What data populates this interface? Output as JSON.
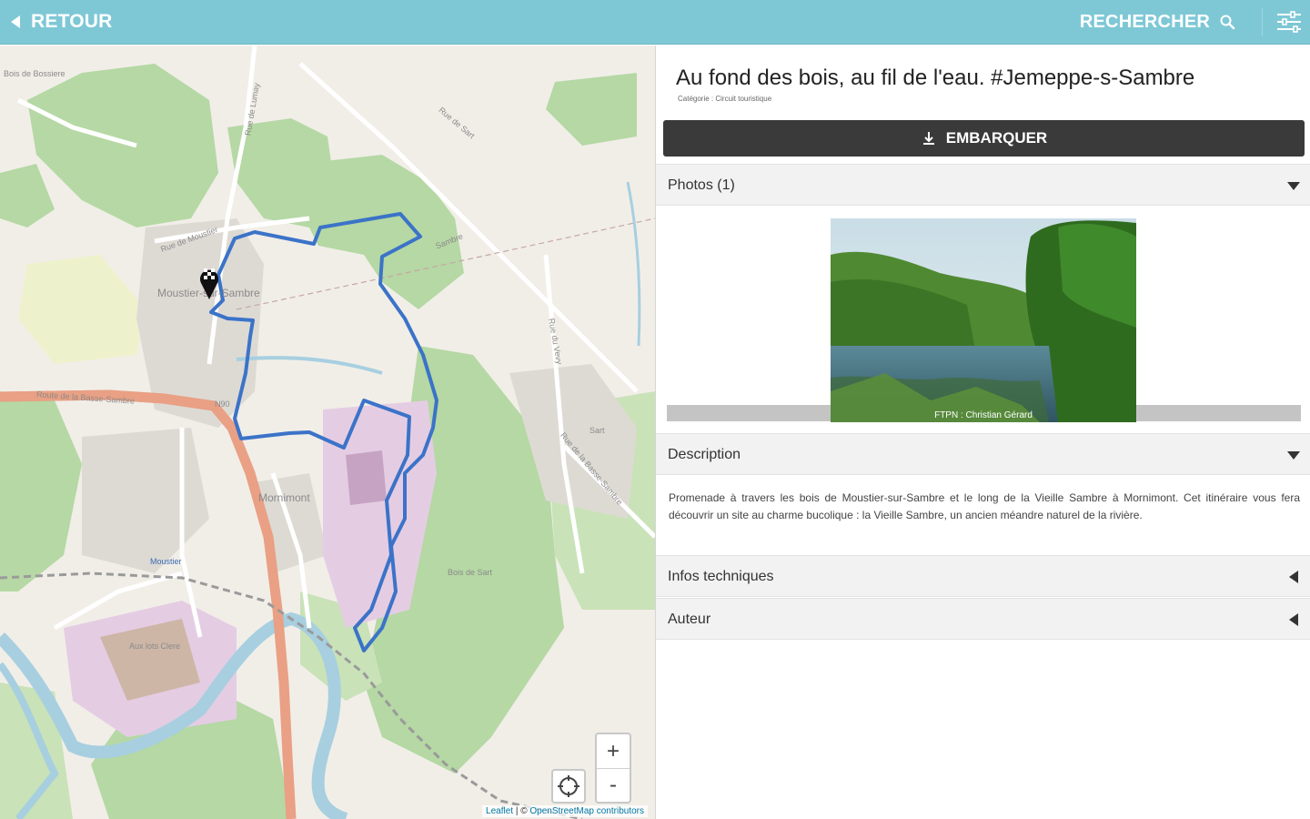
{
  "topbar": {
    "back_label": "RETOUR",
    "search_label": "RECHERCHER",
    "bg_color": "#7ec8d6"
  },
  "map": {
    "labels": {
      "moustier": "Moustier-sur-Sambre",
      "mornimont": "Mornimont",
      "moustier_station": "Moustier",
      "bois_de_sart": "Bois de Sart",
      "rue_de_la_basse_sambre": "Route de la Basse-Sambre",
      "route_n90": "N90",
      "rue_de_sart": "Rue de Sart",
      "rue_du_vevy": "Rue du Vevy",
      "rue_de_la_basse_sambre2": "Rue de la Basse-Sambre",
      "rue_de_moustier": "Rue de Moustier",
      "aux_lots": "Aux lots Clere",
      "bois_de_bossiere": "Bois de Bossiere",
      "rue_de_lumay": "Rue de Lumay",
      "sart": "Sart",
      "sambre": "Sambre"
    },
    "zoom_in_label": "+",
    "zoom_out_label": "-",
    "attribution_leaflet": "Leaflet",
    "attribution_sep": " | © ",
    "attribution_osm": "OpenStreetMap contributors",
    "track_color": "#3b73c8"
  },
  "panel": {
    "title": "Au fond des bois, au fil de l'eau. #Jemeppe-s-Sambre",
    "category": "Catégorie : Circuit touristique",
    "embark_label": "EMBARQUER",
    "sections": {
      "photos": "Photos (1)",
      "description": "Description",
      "infos": "Infos techniques",
      "auteur": "Auteur"
    },
    "photo_credit": "FTPN : Christian Gérard",
    "description_text": "Promenade à travers les bois de Moustier-sur-Sambre et le long de la Vieille Sambre à Mornimont. Cet itinéraire vous fera découvrir un site au charme bucolique : la Vieille Sambre, un ancien méandre naturel de la rivière."
  }
}
